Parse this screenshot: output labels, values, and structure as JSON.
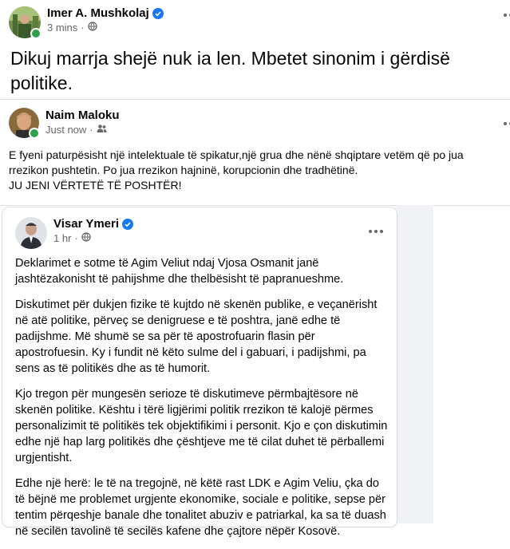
{
  "post1": {
    "author": "Imer A. Mushkolaj",
    "time": "3 mins",
    "text": "Dikuj marrja shejë nuk ia len. Mbetet sinonim i gërdisë politike.",
    "audience_icon": "globe-icon"
  },
  "post2": {
    "author": "Naim Maloku",
    "time": "Just now",
    "audience_icon": "friends-icon",
    "lines": [
      "E fyeni paturpësisht një intelektuale të spikatur,një grua dhe nënë shqiptare vetëm që po jua",
      "rrezikon pushtetin. Po jua rrezikon hajninë, korupcionin dhe tradhëtinë.",
      "JU JENI VËRTETË TË POSHTËR!"
    ]
  },
  "post3": {
    "author": "Visar Ymeri",
    "time": "1 hr",
    "audience_icon": "globe-icon",
    "paragraphs": [
      "Deklarimet e sotme të Agim Veliut ndaj Vjosa Osmanit janë jashtëzakonisht të pahijshme dhe thelbësisht të papranueshme.",
      "Diskutimet për dukjen fizike të kujtdo në skenën publike, e veçanërisht në atë politike, përveç se denigruese e të poshtra, janë edhe të padijshme. Më shumë se sa për të apostrofuarin flasin për apostrofuesin. Ky i fundit në këto sulme del i gabuari, i padijshmi, pa sens as të politikës dhe as të humorit.",
      "Kjo tregon për mungesën serioze të diskutimeve përmbajtësore në skenën politike. Kështu i tërë ligjërimi politik rrezikon të kalojë përmes personalizimit të politikës tek objektifikimi i personit. Kjo e çon diskutimin edhe një hap larg politikës dhe çështjeve me të cilat duhet të përballemi urgjentisht.",
      "Edhe një herë: le të na tregojnë, në këtë rast LDK e Agim Veliu, çka do të bëjnë me problemet urgjente ekonomike, sociale e politike, sepse për tentim përqeshje banale dhe tonalitet abuziv e patriarkal, ka sa të duash në secilën tavolinë të secilës kafene dhe çajtore nëpër Kosovë."
    ]
  },
  "colors": {
    "verified": "#1877f2",
    "online": "#31a24c",
    "meta_text": "#65676b"
  }
}
